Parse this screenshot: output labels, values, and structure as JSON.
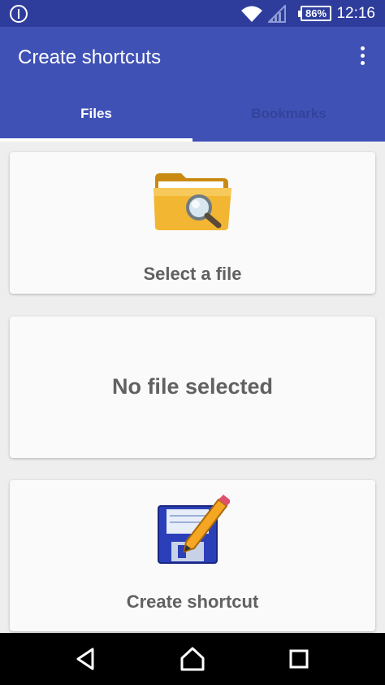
{
  "status_bar": {
    "battery": "86%",
    "time": "12:16",
    "icons": [
      "notification-icon",
      "wifi-icon",
      "signal-icon",
      "battery-icon"
    ]
  },
  "app_bar": {
    "title": "Create shortcuts",
    "menu_icon": "overflow-menu-icon"
  },
  "tabs": [
    {
      "label": "Files",
      "selected": true
    },
    {
      "label": "Bookmarks",
      "selected": false
    }
  ],
  "cards": {
    "select_file": {
      "label": "Select a file",
      "icon": "folder-search-icon"
    },
    "file_status": {
      "label": "No file selected"
    },
    "create_shortcut": {
      "label": "Create shortcut",
      "icon": "floppy-pencil-icon"
    }
  },
  "nav_bar": {
    "icons": [
      "back-icon",
      "home-icon",
      "recents-icon"
    ]
  },
  "colors": {
    "status_bar": "#2e3d9c",
    "primary": "#3f51b5",
    "tab_inactive_text": "#33439a",
    "card_text": "#616161",
    "background": "#eeeeee"
  }
}
